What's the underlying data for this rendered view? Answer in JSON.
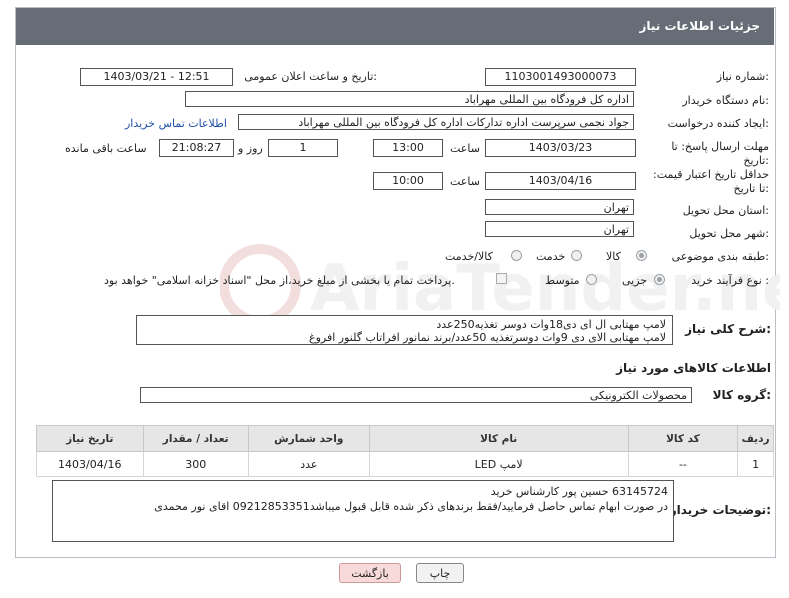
{
  "header": {
    "title": "جزئیات اطلاعات نیاز"
  },
  "fields": {
    "need_number_label": "شماره نیاز:",
    "need_number": "1103001493000073",
    "announce_label": "تاریخ و ساعت اعلان عمومی:",
    "announce_value": "1403/03/21 - 12:51",
    "buyer_org_label": "نام دستگاه خریدار:",
    "buyer_org": "اداره کل فرودگاه بین المللی مهراباد",
    "creator_label": "ایجاد کننده درخواست:",
    "creator": "جواد نجمی سرپرست اداره تدارکات  اداره کل فرودگاه بین المللی مهراباد",
    "contact_link": "اطلاعات تماس خریدار",
    "deadline_label": "مهلت ارسال پاسخ: تا تاریخ:",
    "deadline_date": "1403/03/23",
    "time_label": "ساعت",
    "deadline_time": "13:00",
    "days_value": "1",
    "days_label": "روز و",
    "remaining_time": "21:08:27",
    "remaining_label": "ساعت باقی مانده",
    "validity_label": "حداقل تاریخ اعتبار قیمت: تا تاریخ:",
    "validity_date": "1403/04/16",
    "validity_time_label": "ساعت",
    "validity_time": "10:00",
    "province_label": "استان محل تحویل:",
    "province": "تهران",
    "city_label": "شهر محل تحویل:",
    "city": "تهران",
    "category_label": "طبقه بندی موضوعی:",
    "category_options": [
      "کالا",
      "خدمت",
      "کالا/خدمت"
    ],
    "process_label": "نوع فرآیند خرید :",
    "process_options": [
      "جزیی",
      "متوسط"
    ],
    "payment_note": "پرداخت تمام یا بخشی از مبلغ خرید،از محل \"اسناد خزانه اسلامی\" خواهد بود."
  },
  "description": {
    "label": "شرح کلی نیاز:",
    "line1": "لامپ مهتابی ال ای دی18وات دوسر تغذیه250عدد",
    "line2": "لامپ مهتابی الای دی 9وات دوسرتغذیه 50عدد/برند نمانور افراتاب گلنور افروغ"
  },
  "goods_section": {
    "title": "اطلاعات کالاهای مورد نیاز",
    "group_label": "گروه کالا:",
    "group_value": "محصولات الکترونیکی"
  },
  "table": {
    "headers": [
      "ردیف",
      "کد کالا",
      "نام کالا",
      "واحد شمارش",
      "تعداد / مقدار",
      "تاریخ نیاز"
    ],
    "rows": [
      [
        "1",
        "--",
        "لامپ LED",
        "عدد",
        "300",
        "1403/04/16"
      ]
    ]
  },
  "buyer_notes": {
    "label": "توضیحات خریدار:",
    "line1": "63145724 حسین پور کارشناس خرید",
    "line2": "در صورت ابهام تماس حاصل فرمایید/فقط برندهای ذکر شده قابل قبول میباشد09212853351 اقای نور محمدی"
  },
  "buttons": {
    "print": "چاپ",
    "back": "بازگشت"
  },
  "colors": {
    "titlebar": "#676d77",
    "link": "#1f4fa8",
    "back_button": "#f8dada"
  }
}
